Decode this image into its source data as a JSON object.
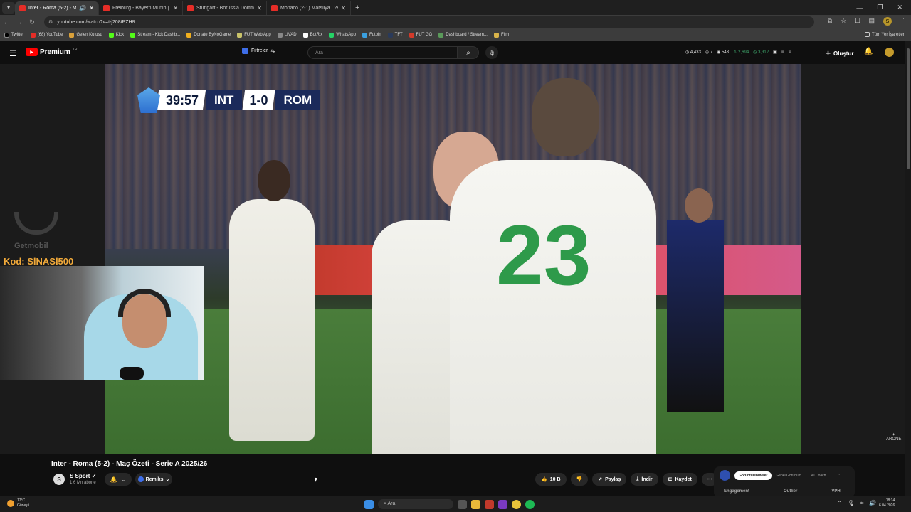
{
  "browser": {
    "tabs": [
      {
        "title": "Inter - Roma (5-2) - Maç Ö",
        "active": true
      },
      {
        "title": "Freiburg - Bayern Münih | Bund",
        "active": false
      },
      {
        "title": "Stuttgart - Borussia Dortmund",
        "active": false
      },
      {
        "title": "Monaco (2-1) Marsilya | 28. Haf",
        "active": false
      }
    ],
    "url": "youtube.com/watch?v=t-j208tPZH8",
    "bookmarks": [
      "Twitter",
      "(68) YouTube",
      "Gelen Kutusu",
      "Kick",
      "Stream - Kick Dashb...",
      "Donate ByNoGame",
      "FUT Web App",
      "LIVAD",
      "BotRix",
      "WhatsApp",
      "Futbin",
      "TFT",
      "FUT GG",
      "Dashboard / Stream...",
      "Film"
    ],
    "bookmarks_right": "Tüm Yer İşaretleri"
  },
  "header": {
    "logo_text": "Premium",
    "logo_region": "TR",
    "filter_label": "Filtreler",
    "search_placeholder": "Ara",
    "stats": [
      "4,433",
      "7",
      "543",
      "2,694",
      "3,312"
    ],
    "create_label": "Oluştur"
  },
  "video": {
    "scorebug": {
      "time": "39:57",
      "home": "INT",
      "score": "1-0",
      "away": "ROM"
    },
    "promo_brand": "Getmobil",
    "promo_code": "Kod: SİNASİ500",
    "watermark": "ARONE"
  },
  "below": {
    "title": "Inter - Roma (5-2) - Maç Özeti - Serie A 2025/26",
    "channel": "S Sport",
    "subscribers": "1,6 Mn abone",
    "remix_label": "Remiks",
    "like_count": "10 B",
    "share_label": "Paylaş",
    "download_label": "İndir",
    "save_label": "Kaydet"
  },
  "panel": {
    "tabs": [
      "Görüntülenmeler",
      "Genel Görünüm",
      "AI Coach"
    ],
    "columns": [
      "Engagement",
      "Outlier",
      "VPH"
    ]
  },
  "taskbar": {
    "temp": "17°C",
    "weather": "Güneşli",
    "search": "Ara",
    "time": "18:14",
    "date": "6.04.2026"
  }
}
